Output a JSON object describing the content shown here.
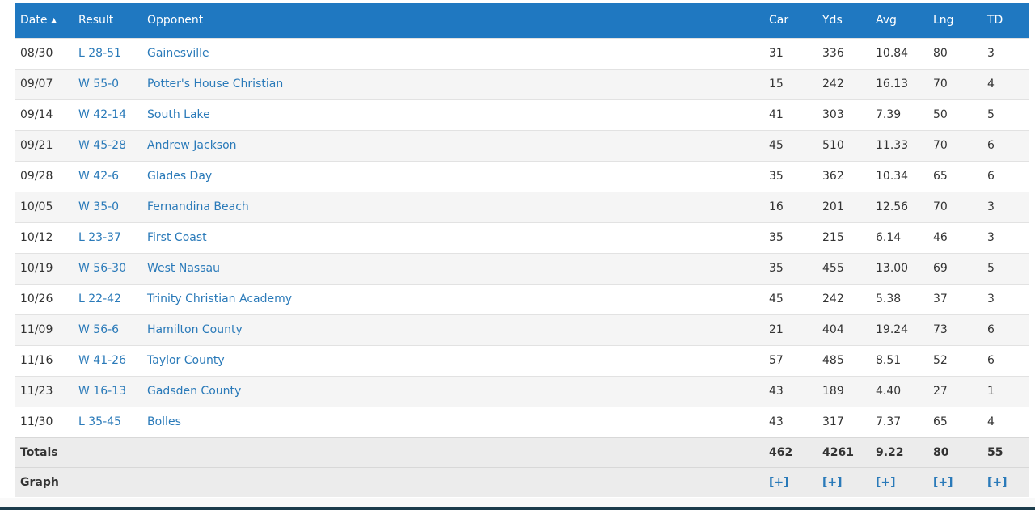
{
  "table": {
    "headers": {
      "date": "Date",
      "result": "Result",
      "opponent": "Opponent",
      "car": "Car",
      "yds": "Yds",
      "avg": "Avg",
      "lng": "Lng",
      "td": "TD"
    },
    "sort_icon": "▲",
    "rows": [
      {
        "date": "08/30",
        "result": "L 28-51",
        "opponent": "Gainesville",
        "car": "31",
        "yds": "336",
        "avg": "10.84",
        "lng": "80",
        "td": "3"
      },
      {
        "date": "09/07",
        "result": "W 55-0",
        "opponent": "Potter's House Christian",
        "car": "15",
        "yds": "242",
        "avg": "16.13",
        "lng": "70",
        "td": "4"
      },
      {
        "date": "09/14",
        "result": "W 42-14",
        "opponent": "South Lake",
        "car": "41",
        "yds": "303",
        "avg": "7.39",
        "lng": "50",
        "td": "5"
      },
      {
        "date": "09/21",
        "result": "W 45-28",
        "opponent": "Andrew Jackson",
        "car": "45",
        "yds": "510",
        "avg": "11.33",
        "lng": "70",
        "td": "6"
      },
      {
        "date": "09/28",
        "result": "W 42-6",
        "opponent": "Glades Day",
        "car": "35",
        "yds": "362",
        "avg": "10.34",
        "lng": "65",
        "td": "6"
      },
      {
        "date": "10/05",
        "result": "W 35-0",
        "opponent": "Fernandina Beach",
        "car": "16",
        "yds": "201",
        "avg": "12.56",
        "lng": "70",
        "td": "3"
      },
      {
        "date": "10/12",
        "result": "L 23-37",
        "opponent": "First Coast",
        "car": "35",
        "yds": "215",
        "avg": "6.14",
        "lng": "46",
        "td": "3"
      },
      {
        "date": "10/19",
        "result": "W 56-30",
        "opponent": "West Nassau",
        "car": "35",
        "yds": "455",
        "avg": "13.00",
        "lng": "69",
        "td": "5"
      },
      {
        "date": "10/26",
        "result": "L 22-42",
        "opponent": "Trinity Christian Academy",
        "car": "45",
        "yds": "242",
        "avg": "5.38",
        "lng": "37",
        "td": "3"
      },
      {
        "date": "11/09",
        "result": "W 56-6",
        "opponent": "Hamilton County",
        "car": "21",
        "yds": "404",
        "avg": "19.24",
        "lng": "73",
        "td": "6"
      },
      {
        "date": "11/16",
        "result": "W 41-26",
        "opponent": "Taylor County",
        "car": "57",
        "yds": "485",
        "avg": "8.51",
        "lng": "52",
        "td": "6"
      },
      {
        "date": "11/23",
        "result": "W 16-13",
        "opponent": "Gadsden County",
        "car": "43",
        "yds": "189",
        "avg": "4.40",
        "lng": "27",
        "td": "1"
      },
      {
        "date": "11/30",
        "result": "L 35-45",
        "opponent": "Bolles",
        "car": "43",
        "yds": "317",
        "avg": "7.37",
        "lng": "65",
        "td": "4"
      }
    ],
    "totals": {
      "label": "Totals",
      "car": "462",
      "yds": "4261",
      "avg": "9.22",
      "lng": "80",
      "td": "55"
    },
    "graph": {
      "label": "Graph",
      "car": "[+]",
      "yds": "[+]",
      "avg": "[+]",
      "lng": "[+]",
      "td": "[+]"
    }
  },
  "colors": {
    "header_bg": "#1f78c1",
    "link": "#2a7ab9",
    "row_alt": "#f5f5f5"
  }
}
